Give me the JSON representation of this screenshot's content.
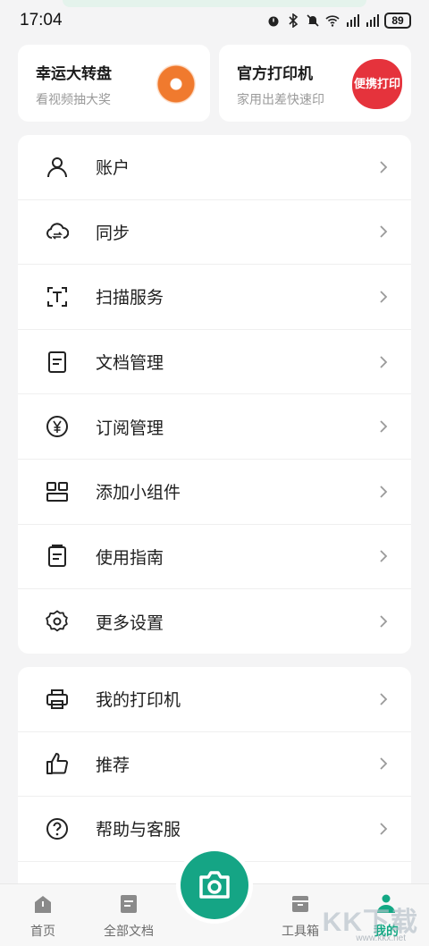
{
  "status_bar": {
    "time": "17:04",
    "battery": "89",
    "signal_labels": [
      "4G",
      "4G"
    ]
  },
  "promos": [
    {
      "title": "幸运大转盘",
      "subtitle": "看视频抽大奖",
      "icon": "lucky-wheel-icon"
    },
    {
      "title": "官方打印机",
      "subtitle": "家用出差快速印",
      "badge": "便携打印",
      "icon": "portable-print-badge"
    }
  ],
  "menu_main": [
    {
      "label": "账户",
      "icon": "person-icon"
    },
    {
      "label": "同步",
      "icon": "cloud-sync-icon"
    },
    {
      "label": "扫描服务",
      "icon": "scan-text-icon"
    },
    {
      "label": "文档管理",
      "icon": "document-icon"
    },
    {
      "label": "订阅管理",
      "icon": "yen-circle-icon"
    },
    {
      "label": "添加小组件",
      "icon": "widgets-icon"
    },
    {
      "label": "使用指南",
      "icon": "guide-icon"
    },
    {
      "label": "更多设置",
      "icon": "gear-icon"
    }
  ],
  "menu_secondary": [
    {
      "label": "我的打印机",
      "icon": "printer-icon"
    },
    {
      "label": "推荐",
      "icon": "thumbs-up-icon"
    },
    {
      "label": "帮助与客服",
      "icon": "help-circle-icon"
    }
  ],
  "tabs": [
    {
      "label": "首页",
      "icon": "home-icon"
    },
    {
      "label": "全部文档",
      "icon": "documents-icon"
    },
    {
      "label": "工具箱",
      "icon": "toolbox-icon"
    },
    {
      "label": "我的",
      "icon": "profile-icon",
      "active": true
    }
  ],
  "camera_button": {
    "icon": "camera-icon"
  },
  "watermark": {
    "main": "KK下载",
    "sub": "www.kkx.net"
  },
  "colors": {
    "accent": "#15a585",
    "active_tab": "#13a884",
    "wheel": "#f07a2e",
    "badge": "#e5333c"
  }
}
